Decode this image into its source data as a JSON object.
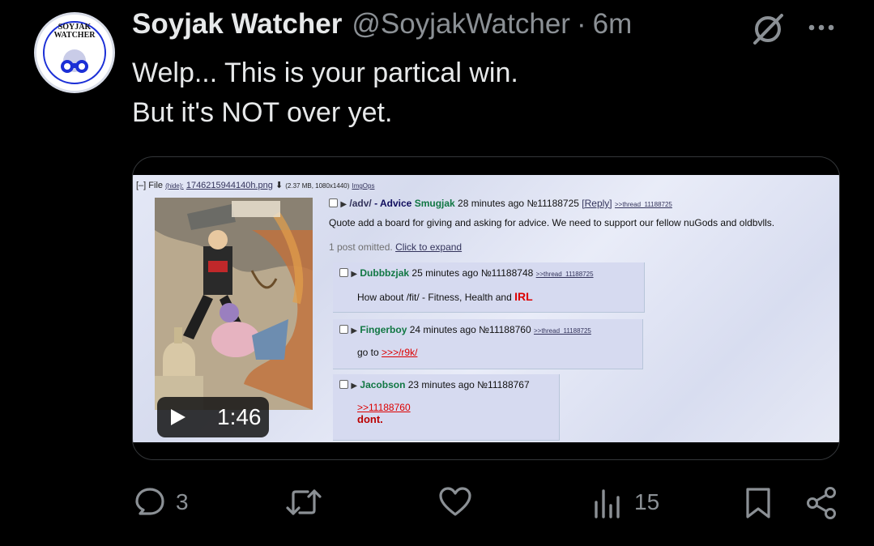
{
  "tweet": {
    "display_name": "Soyjak Watcher",
    "handle": "@SoyjakWatcher",
    "separator": "·",
    "time": "6m",
    "avatar_text_1": "SOYJAK",
    "avatar_text_2": "WATCHER",
    "text_lines": [
      "Welp... This is your partical win.",
      "But it's NOT over yet."
    ]
  },
  "media": {
    "duration": "1:46",
    "file_label": "[–] File",
    "file_hide": "(hide):",
    "file_name": "1746215944140h.png",
    "file_meta": "(2.37 MB, 1080x1440)",
    "file_imgops": "ImgOps",
    "op": {
      "board": "/adv/",
      "dash": "- Advice",
      "name": "Smugjak",
      "time": "28 minutes ago",
      "post_no": "№11188725",
      "reply_link": "[Reply]",
      "thread_link": ">>thread_11188725",
      "body": "Quote add a board for giving and asking for advice. We need to support our fellow nuGods and oldbvlls.",
      "omitted": "1 post omitted.",
      "expand": "Click to expand"
    },
    "replies": [
      {
        "name": "Dubbbzjak",
        "time": "25 minutes ago",
        "post_no": "№11188748",
        "thread": ">>thread_11188725",
        "body": "How about /fit/ - Fitness, Health and",
        "body_red": "IRL"
      },
      {
        "name": "Fingerboy",
        "time": "24 minutes ago",
        "post_no": "№11188760",
        "thread": ">>thread_11188725",
        "body": "go to",
        "body_link": ">>>/r9k/"
      },
      {
        "name": "Jacobson",
        "time": "23 minutes ago",
        "post_no": "№11188767",
        "quote": ">>11188760",
        "body_red": "dont."
      }
    ]
  },
  "actions": {
    "replies": "3",
    "retweets": "",
    "likes": "",
    "views": "15"
  },
  "icons": {
    "grok": "grok-icon",
    "more": "more-icon",
    "reply": "reply-icon",
    "retweet": "retweet-icon",
    "like": "heart-icon",
    "views": "views-icon",
    "bookmark": "bookmark-icon",
    "share": "share-icon"
  },
  "colors": {
    "background": "#000000",
    "text": "#e7e9ea",
    "secondary": "#8b9095",
    "border": "#333639"
  }
}
